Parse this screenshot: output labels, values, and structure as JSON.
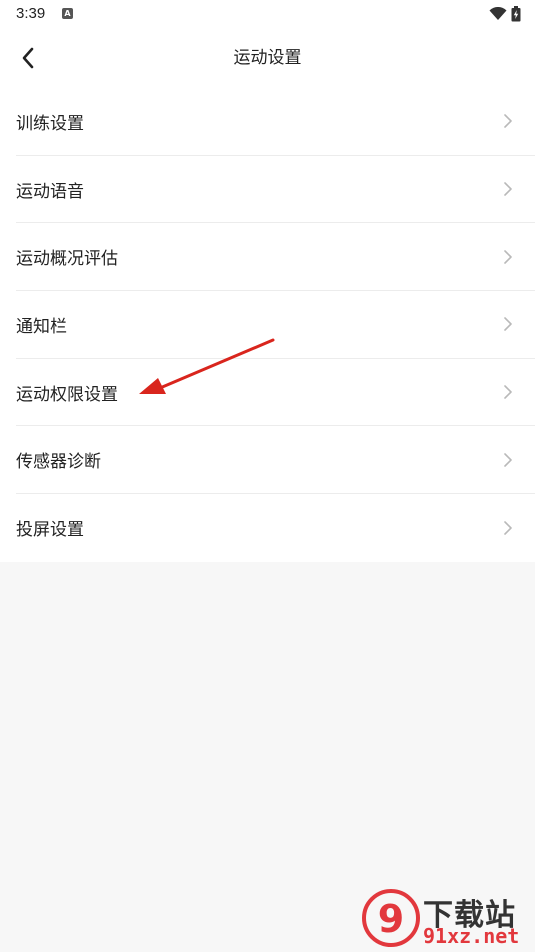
{
  "status_bar": {
    "time": "3:39",
    "notification_letter": "A",
    "icons": [
      "wifi-icon",
      "battery-charging-icon"
    ]
  },
  "header": {
    "back_icon": "chevron-left-icon",
    "title": "运动设置"
  },
  "settings_list": [
    {
      "label": "训练设置"
    },
    {
      "label": "运动语音"
    },
    {
      "label": "运动概况评估"
    },
    {
      "label": "通知栏"
    },
    {
      "label": "运动权限设置"
    },
    {
      "label": "传感器诊断"
    },
    {
      "label": "投屏设置"
    }
  ],
  "annotation": {
    "arrow_color": "#d9251d",
    "points_to": "运动权限设置"
  },
  "watermark": {
    "logo_text": "9",
    "top_text": "下载站",
    "bottom_text": "91xz.net"
  },
  "colors": {
    "accent_red": "#e2383d",
    "background": "#f7f7f7",
    "list_background": "#ffffff",
    "divider": "#ececec"
  }
}
